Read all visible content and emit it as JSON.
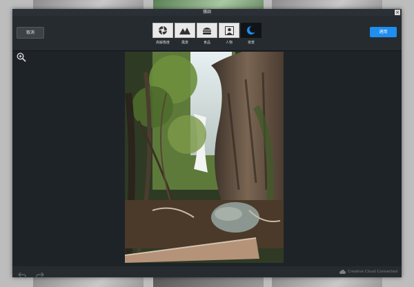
{
  "window": {
    "title": "彌調"
  },
  "toolbar": {
    "cancel_label": "取消",
    "apply_label": "適用",
    "modes": [
      {
        "label": "高解像度",
        "icon": "aperture-icon",
        "active": false
      },
      {
        "label": "風景",
        "icon": "mountains-icon",
        "active": false
      },
      {
        "label": "食品",
        "icon": "burger-icon",
        "active": false
      },
      {
        "label": "人物",
        "icon": "portrait-icon",
        "active": false
      },
      {
        "label": "夜景",
        "icon": "moon-icon",
        "active": true
      }
    ]
  },
  "status": {
    "cloud": "Creative Cloud Connected"
  },
  "colors": {
    "accent": "#1e8ef0",
    "dialog_bg": "#1e2328",
    "toolbar_bg": "#262b30"
  }
}
